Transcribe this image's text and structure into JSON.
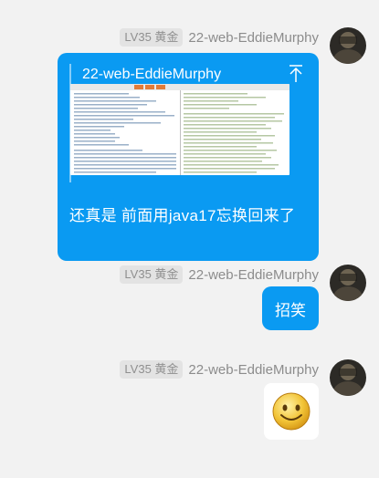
{
  "messages": [
    {
      "level_badge": "LV35 黄金",
      "sender": "22-web-EddieMurphy",
      "forward_title": "22-web-EddieMurphy",
      "forward_text": "还真是  前面用java17忘换回来了"
    },
    {
      "level_badge": "LV35 黄金",
      "sender": "22-web-EddieMurphy",
      "text": "招笑"
    },
    {
      "level_badge": "LV35 黄金",
      "sender": "22-web-EddieMurphy",
      "sticker": "smiley-face-sticker"
    }
  ],
  "colors": {
    "bubble": "#0a9af2",
    "background": "#f2f2f2",
    "badge_bg": "#e3e3e3"
  },
  "icons": {
    "pin": "pin-top-icon",
    "avatar": "user-avatar"
  }
}
